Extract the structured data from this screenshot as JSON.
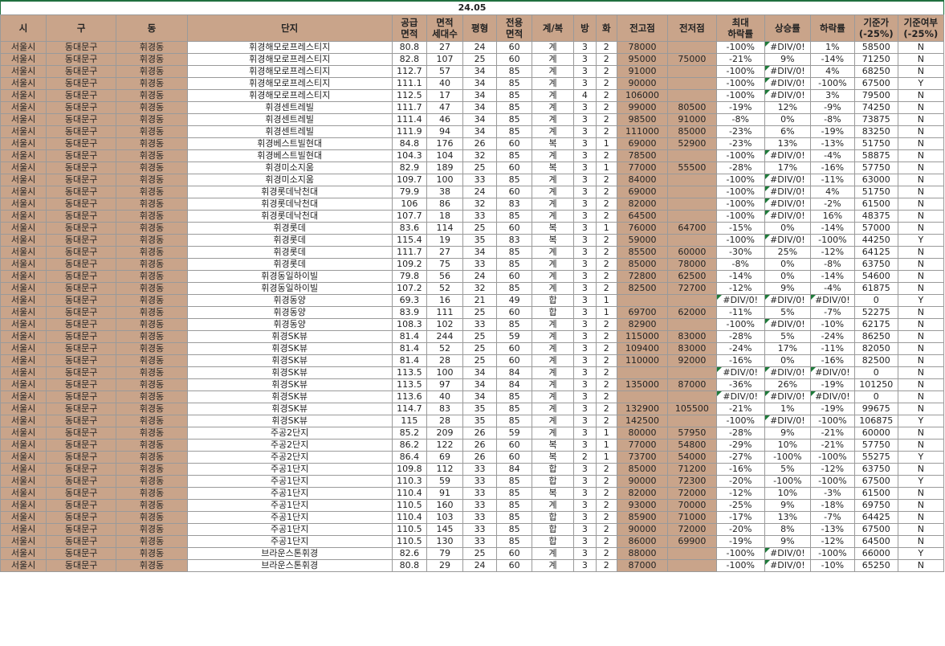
{
  "sheet": {
    "title": "24.05",
    "headers": [
      "시",
      "구",
      "동",
      "단지",
      "공급\n면적",
      "면적\n세대수",
      "평형",
      "전용\n면적",
      "계/복",
      "방",
      "화",
      "전고점",
      "전저점",
      "최대\n하락률",
      "상승률",
      "하락률",
      "기준가\n(-25%)",
      "기준여부\n(-25%)"
    ],
    "rows": [
      [
        "서울시",
        "동대문구",
        "휘경동",
        "휘경해모로프레스티지",
        "80.8",
        "27",
        "24",
        "60",
        "계",
        "3",
        "2",
        "78000",
        "",
        "-100%",
        "#DIV/0!",
        "1%",
        "58500",
        "N"
      ],
      [
        "서울시",
        "동대문구",
        "휘경동",
        "휘경해모로프레스티지",
        "82.8",
        "107",
        "25",
        "60",
        "계",
        "3",
        "2",
        "95000",
        "75000",
        "-21%",
        "9%",
        "-14%",
        "71250",
        "N"
      ],
      [
        "서울시",
        "동대문구",
        "휘경동",
        "휘경해모로프레스티지",
        "112.7",
        "57",
        "34",
        "85",
        "계",
        "3",
        "2",
        "91000",
        "",
        "-100%",
        "#DIV/0!",
        "4%",
        "68250",
        "N"
      ],
      [
        "서울시",
        "동대문구",
        "휘경동",
        "휘경해모로프레스티지",
        "111.1",
        "40",
        "34",
        "85",
        "계",
        "3",
        "2",
        "90000",
        "",
        "-100%",
        "#DIV/0!",
        "-100%",
        "67500",
        "Y"
      ],
      [
        "서울시",
        "동대문구",
        "휘경동",
        "휘경해모로프레스티지",
        "112.5",
        "17",
        "34",
        "85",
        "계",
        "4",
        "2",
        "106000",
        "",
        "-100%",
        "#DIV/0!",
        "3%",
        "79500",
        "N"
      ],
      [
        "서울시",
        "동대문구",
        "휘경동",
        "휘경센트레빌",
        "111.7",
        "47",
        "34",
        "85",
        "계",
        "3",
        "2",
        "99000",
        "80500",
        "-19%",
        "12%",
        "-9%",
        "74250",
        "N"
      ],
      [
        "서울시",
        "동대문구",
        "휘경동",
        "휘경센트레빌",
        "111.4",
        "46",
        "34",
        "85",
        "계",
        "3",
        "2",
        "98500",
        "91000",
        "-8%",
        "0%",
        "-8%",
        "73875",
        "N"
      ],
      [
        "서울시",
        "동대문구",
        "휘경동",
        "휘경센트레빌",
        "111.9",
        "94",
        "34",
        "85",
        "계",
        "3",
        "2",
        "111000",
        "85000",
        "-23%",
        "6%",
        "-19%",
        "83250",
        "N"
      ],
      [
        "서울시",
        "동대문구",
        "휘경동",
        "휘경베스트빌현대",
        "84.8",
        "176",
        "26",
        "60",
        "복",
        "3",
        "1",
        "69000",
        "52900",
        "-23%",
        "13%",
        "-13%",
        "51750",
        "N"
      ],
      [
        "서울시",
        "동대문구",
        "휘경동",
        "휘경베스트빌현대",
        "104.3",
        "104",
        "32",
        "85",
        "계",
        "3",
        "2",
        "78500",
        "",
        "-100%",
        "#DIV/0!",
        "-4%",
        "58875",
        "N"
      ],
      [
        "서울시",
        "동대문구",
        "휘경동",
        "휘경미소지움",
        "82.9",
        "189",
        "25",
        "60",
        "복",
        "3",
        "1",
        "77000",
        "55500",
        "-28%",
        "17%",
        "-16%",
        "57750",
        "N"
      ],
      [
        "서울시",
        "동대문구",
        "휘경동",
        "휘경미소지움",
        "109.7",
        "100",
        "33",
        "85",
        "계",
        "3",
        "2",
        "84000",
        "",
        "-100%",
        "#DIV/0!",
        "-11%",
        "63000",
        "N"
      ],
      [
        "서울시",
        "동대문구",
        "휘경동",
        "휘경롯데낙천대",
        "79.9",
        "38",
        "24",
        "60",
        "계",
        "3",
        "2",
        "69000",
        "",
        "-100%",
        "#DIV/0!",
        "4%",
        "51750",
        "N"
      ],
      [
        "서울시",
        "동대문구",
        "휘경동",
        "휘경롯데낙천대",
        "106",
        "86",
        "32",
        "83",
        "계",
        "3",
        "2",
        "82000",
        "",
        "-100%",
        "#DIV/0!",
        "-2%",
        "61500",
        "N"
      ],
      [
        "서울시",
        "동대문구",
        "휘경동",
        "휘경롯데낙천대",
        "107.7",
        "18",
        "33",
        "85",
        "계",
        "3",
        "2",
        "64500",
        "",
        "-100%",
        "#DIV/0!",
        "16%",
        "48375",
        "N"
      ],
      [
        "서울시",
        "동대문구",
        "휘경동",
        "휘경롯데",
        "83.6",
        "114",
        "25",
        "60",
        "복",
        "3",
        "1",
        "76000",
        "64700",
        "-15%",
        "0%",
        "-14%",
        "57000",
        "N"
      ],
      [
        "서울시",
        "동대문구",
        "휘경동",
        "휘경롯데",
        "115.4",
        "19",
        "35",
        "83",
        "복",
        "3",
        "2",
        "59000",
        "",
        "-100%",
        "#DIV/0!",
        "-100%",
        "44250",
        "Y"
      ],
      [
        "서울시",
        "동대문구",
        "휘경동",
        "휘경롯데",
        "111.7",
        "27",
        "34",
        "85",
        "계",
        "3",
        "2",
        "85500",
        "60000",
        "-30%",
        "25%",
        "-12%",
        "64125",
        "N"
      ],
      [
        "서울시",
        "동대문구",
        "휘경동",
        "휘경롯데",
        "109.2",
        "75",
        "33",
        "85",
        "계",
        "3",
        "2",
        "85000",
        "78000",
        "-8%",
        "0%",
        "-8%",
        "63750",
        "N"
      ],
      [
        "서울시",
        "동대문구",
        "휘경동",
        "휘경동일하이빌",
        "79.8",
        "56",
        "24",
        "60",
        "계",
        "3",
        "2",
        "72800",
        "62500",
        "-14%",
        "0%",
        "-14%",
        "54600",
        "N"
      ],
      [
        "서울시",
        "동대문구",
        "휘경동",
        "휘경동일하이빌",
        "107.2",
        "52",
        "32",
        "85",
        "계",
        "3",
        "2",
        "82500",
        "72700",
        "-12%",
        "9%",
        "-4%",
        "61875",
        "N"
      ],
      [
        "서울시",
        "동대문구",
        "휘경동",
        "휘경동양",
        "69.3",
        "16",
        "21",
        "49",
        "합",
        "3",
        "1",
        "",
        "",
        "#DIV/0!",
        "#DIV/0!",
        "#DIV/0!",
        "0",
        "Y"
      ],
      [
        "서울시",
        "동대문구",
        "휘경동",
        "휘경동양",
        "83.9",
        "111",
        "25",
        "60",
        "합",
        "3",
        "1",
        "69700",
        "62000",
        "-11%",
        "5%",
        "-7%",
        "52275",
        "N"
      ],
      [
        "서울시",
        "동대문구",
        "휘경동",
        "휘경동양",
        "108.3",
        "102",
        "33",
        "85",
        "계",
        "3",
        "2",
        "82900",
        "",
        "-100%",
        "#DIV/0!",
        "-10%",
        "62175",
        "N"
      ],
      [
        "서울시",
        "동대문구",
        "휘경동",
        "휘경SK뷰",
        "81.4",
        "244",
        "25",
        "59",
        "계",
        "3",
        "2",
        "115000",
        "83000",
        "-28%",
        "5%",
        "-24%",
        "86250",
        "N"
      ],
      [
        "서울시",
        "동대문구",
        "휘경동",
        "휘경SK뷰",
        "81.4",
        "52",
        "25",
        "60",
        "계",
        "3",
        "2",
        "109400",
        "83000",
        "-24%",
        "17%",
        "-11%",
        "82050",
        "N"
      ],
      [
        "서울시",
        "동대문구",
        "휘경동",
        "휘경SK뷰",
        "81.4",
        "28",
        "25",
        "60",
        "계",
        "3",
        "2",
        "110000",
        "92000",
        "-16%",
        "0%",
        "-16%",
        "82500",
        "N"
      ],
      [
        "서울시",
        "동대문구",
        "휘경동",
        "휘경SK뷰",
        "113.5",
        "100",
        "34",
        "84",
        "계",
        "3",
        "2",
        "",
        "",
        "#DIV/0!",
        "#DIV/0!",
        "#DIV/0!",
        "0",
        "N"
      ],
      [
        "서울시",
        "동대문구",
        "휘경동",
        "휘경SK뷰",
        "113.5",
        "97",
        "34",
        "84",
        "계",
        "3",
        "2",
        "135000",
        "87000",
        "-36%",
        "26%",
        "-19%",
        "101250",
        "N"
      ],
      [
        "서울시",
        "동대문구",
        "휘경동",
        "휘경SK뷰",
        "113.6",
        "40",
        "34",
        "85",
        "계",
        "3",
        "2",
        "",
        "",
        "#DIV/0!",
        "#DIV/0!",
        "#DIV/0!",
        "0",
        "N"
      ],
      [
        "서울시",
        "동대문구",
        "휘경동",
        "휘경SK뷰",
        "114.7",
        "83",
        "35",
        "85",
        "계",
        "3",
        "2",
        "132900",
        "105500",
        "-21%",
        "1%",
        "-19%",
        "99675",
        "N"
      ],
      [
        "서울시",
        "동대문구",
        "휘경동",
        "휘경SK뷰",
        "115",
        "28",
        "35",
        "85",
        "계",
        "3",
        "2",
        "142500",
        "",
        "-100%",
        "#DIV/0!",
        "-100%",
        "106875",
        "Y"
      ],
      [
        "서울시",
        "동대문구",
        "휘경동",
        "주공2단지",
        "85.2",
        "209",
        "26",
        "59",
        "계",
        "3",
        "1",
        "80000",
        "57950",
        "-28%",
        "9%",
        "-21%",
        "60000",
        "N"
      ],
      [
        "서울시",
        "동대문구",
        "휘경동",
        "주공2단지",
        "86.2",
        "122",
        "26",
        "60",
        "복",
        "3",
        "1",
        "77000",
        "54800",
        "-29%",
        "10%",
        "-21%",
        "57750",
        "N"
      ],
      [
        "서울시",
        "동대문구",
        "휘경동",
        "주공2단지",
        "86.4",
        "69",
        "26",
        "60",
        "복",
        "2",
        "1",
        "73700",
        "54000",
        "-27%",
        "-100%",
        "-100%",
        "55275",
        "Y"
      ],
      [
        "서울시",
        "동대문구",
        "휘경동",
        "주공1단지",
        "109.8",
        "112",
        "33",
        "84",
        "합",
        "3",
        "2",
        "85000",
        "71200",
        "-16%",
        "5%",
        "-12%",
        "63750",
        "N"
      ],
      [
        "서울시",
        "동대문구",
        "휘경동",
        "주공1단지",
        "110.3",
        "59",
        "33",
        "85",
        "합",
        "3",
        "2",
        "90000",
        "72300",
        "-20%",
        "-100%",
        "-100%",
        "67500",
        "Y"
      ],
      [
        "서울시",
        "동대문구",
        "휘경동",
        "주공1단지",
        "110.4",
        "91",
        "33",
        "85",
        "복",
        "3",
        "2",
        "82000",
        "72000",
        "-12%",
        "10%",
        "-3%",
        "61500",
        "N"
      ],
      [
        "서울시",
        "동대문구",
        "휘경동",
        "주공1단지",
        "110.5",
        "160",
        "33",
        "85",
        "계",
        "3",
        "2",
        "93000",
        "70000",
        "-25%",
        "9%",
        "-18%",
        "69750",
        "N"
      ],
      [
        "서울시",
        "동대문구",
        "휘경동",
        "주공1단지",
        "110.4",
        "103",
        "33",
        "85",
        "합",
        "3",
        "2",
        "85900",
        "71000",
        "-17%",
        "13%",
        "-7%",
        "64425",
        "N"
      ],
      [
        "서울시",
        "동대문구",
        "휘경동",
        "주공1단지",
        "110.5",
        "145",
        "33",
        "85",
        "합",
        "3",
        "2",
        "90000",
        "72000",
        "-20%",
        "8%",
        "-13%",
        "67500",
        "N"
      ],
      [
        "서울시",
        "동대문구",
        "휘경동",
        "주공1단지",
        "110.5",
        "130",
        "33",
        "85",
        "합",
        "3",
        "2",
        "86000",
        "69900",
        "-19%",
        "9%",
        "-12%",
        "64500",
        "N"
      ],
      [
        "서울시",
        "동대문구",
        "휘경동",
        "브라운스톤휘경",
        "82.6",
        "79",
        "25",
        "60",
        "계",
        "3",
        "2",
        "88000",
        "",
        "-100%",
        "#DIV/0!",
        "-100%",
        "66000",
        "Y"
      ],
      [
        "서울시",
        "동대문구",
        "휘경동",
        "브라운스톤휘경",
        "80.8",
        "29",
        "24",
        "60",
        "계",
        "3",
        "2",
        "87000",
        "",
        "-100%",
        "#DIV/0!",
        "-10%",
        "65250",
        "N"
      ]
    ]
  },
  "colors": {
    "header_bg": "#c9a48a",
    "accent_green": "#1f6f3f",
    "grid": "#9a9a9a"
  }
}
